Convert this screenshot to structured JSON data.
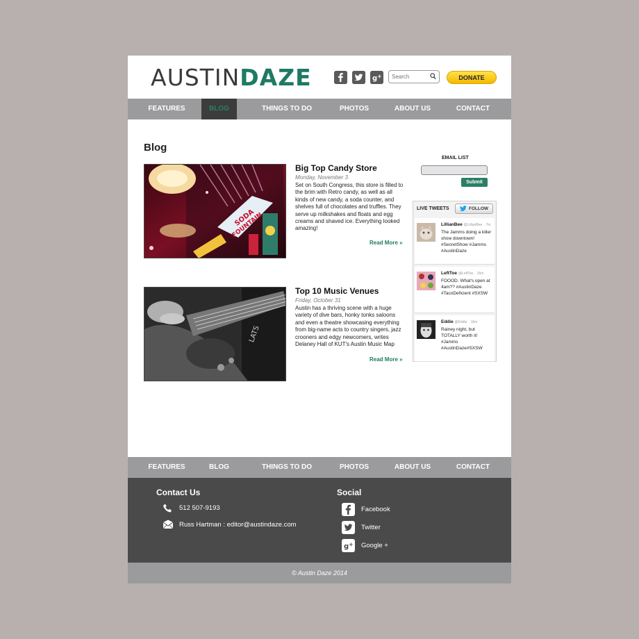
{
  "logo": {
    "part1": "AUSTIN",
    "part2": "DAZE"
  },
  "header": {
    "social": [
      {
        "icon": "facebook-icon",
        "glyph": "f"
      },
      {
        "icon": "twitter-icon",
        "glyph": "t"
      },
      {
        "icon": "google-plus-icon",
        "glyph": "g+"
      }
    ],
    "search_placeholder": "Search",
    "donate_label": "DONATE"
  },
  "nav": {
    "items": [
      "FEATURES",
      "BLOG",
      "THINGS TO DO",
      "PHOTOS",
      "ABOUT US",
      "CONTACT"
    ],
    "active": "BLOG"
  },
  "main": {
    "heading": "Blog",
    "posts": [
      {
        "title": "Big Top Candy Store",
        "date": "Monday, November 3",
        "body": "Set on South Congress, this store is filled to the brim with Retro candy, as well as all kinds of new candy, a soda counter, and shelves full of chocolates and truffles. They serve up milkshakes and floats and egg creams and shaved ice. Everything looked amazing!",
        "read_more": "Read More »"
      },
      {
        "title": "Top 10 Music Venues",
        "date": "Friday, October 31",
        "body": "Austin has a thriving scene with a huge variety of dive bars, honky tonks saloons and even a theatre showcasing everything from big-name acts to country singers, jazz crooners and edgy newcomers, writes Delaney Hall of KUT's Austin Music Map",
        "read_more": "Read More »"
      }
    ]
  },
  "sidebar": {
    "email_label": "EMAIL LIST",
    "submit_label": "Submit",
    "live_tweets_label": "LIVE TWEETS",
    "follow_label": "FOLLOW",
    "tweets": [
      {
        "name": "LillianBee",
        "handle": "@LillianBee",
        "time": "7m",
        "text": "The Jamms doing a killer show downtown! #SecretShow #Jamms #AustinDaze"
      },
      {
        "name": "LeftToe",
        "handle": "@LeftToe",
        "time": "16m",
        "text": "FOOOD. What's open at 4am?? #AustinDaze #TacoDeficient #SXSW"
      },
      {
        "name": "Eddie",
        "handle": "@Eddie",
        "time": "16m",
        "text": "Rainey night, but TOTALLY worth it! #Jamms #AustinDaze#SXSW"
      }
    ]
  },
  "footer_nav": {
    "items": [
      "FEATURES",
      "BLOG",
      "THINGS TO DO",
      "PHOTOS",
      "ABOUT US",
      "CONTACT"
    ]
  },
  "footer": {
    "contact_heading": "Contact Us",
    "phone": "512 507-9193",
    "email_line": "Russ Hartman : editor@austindaze.com",
    "social_heading": "Social",
    "social_links": [
      "Facebook",
      "Twitter",
      "Google +"
    ]
  },
  "copyright": "© Austin Daze 2014",
  "colors": {
    "accent_green": "#1f7a63",
    "nav_gray": "#9b9b9d",
    "footer_dark": "#4a4a4a",
    "donate_yellow": "#f5c400"
  }
}
